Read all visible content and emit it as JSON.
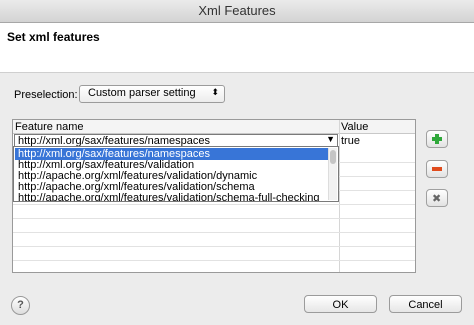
{
  "window": {
    "title": "Xml Features"
  },
  "header": {
    "title": "Set xml features"
  },
  "preselection": {
    "label": "Preselection:",
    "value": "Custom parser setting"
  },
  "table": {
    "columns": [
      "Feature name",
      "Value"
    ],
    "edit_row": {
      "feature": "http://xml.org/sax/features/namespaces",
      "value": "true"
    }
  },
  "dropdown": {
    "options": [
      "http://xml.org/sax/features/namespaces",
      "http://xml.org/sax/features/validation",
      "http://apache.org/xml/features/validation/dynamic",
      "http://apache.org/xml/features/validation/schema",
      "http://apache.org/xml/features/validation/schema-full-checking"
    ],
    "selected_index": 0
  },
  "side_buttons": {
    "add_icon": "plus-icon",
    "remove_icon": "minus-icon",
    "clear_icon": "clear-icon"
  },
  "buttons": {
    "ok": "OK",
    "cancel": "Cancel"
  },
  "help": {
    "icon": "help-icon",
    "glyph": "?"
  },
  "colors": {
    "selection": "#3875d7",
    "add": "#2fa83a",
    "remove": "#e04b1c"
  }
}
